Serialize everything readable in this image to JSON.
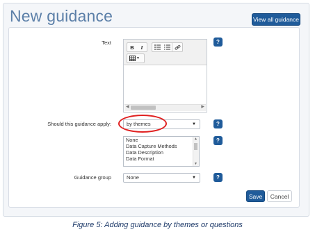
{
  "page": {
    "title": "New guidance",
    "view_all_label": "View all guidance"
  },
  "form": {
    "text_label": "Text",
    "apply_label": "Should this guidance apply:",
    "apply_value": "by themes",
    "themes_options": [
      "None",
      "Data Capture Methods",
      "Data Description",
      "Data Format"
    ],
    "group_label": "Guidance group",
    "group_value": "None",
    "help_glyph": "?"
  },
  "editor_toolbar": {
    "bold": "B",
    "italic": "I",
    "bullet_list_icon": "bullet-list-icon",
    "numbered_list_icon": "numbered-list-icon",
    "link_icon": "link-icon",
    "table_icon": "table-icon"
  },
  "actions": {
    "save_label": "Save",
    "cancel_label": "Cancel"
  },
  "caption": "Figure 5: Adding guidance by themes or questions",
  "colors": {
    "primary": "#1f5b9a",
    "title": "#5b7fa8",
    "highlight": "#e02020",
    "caption": "#1f3b6a"
  }
}
